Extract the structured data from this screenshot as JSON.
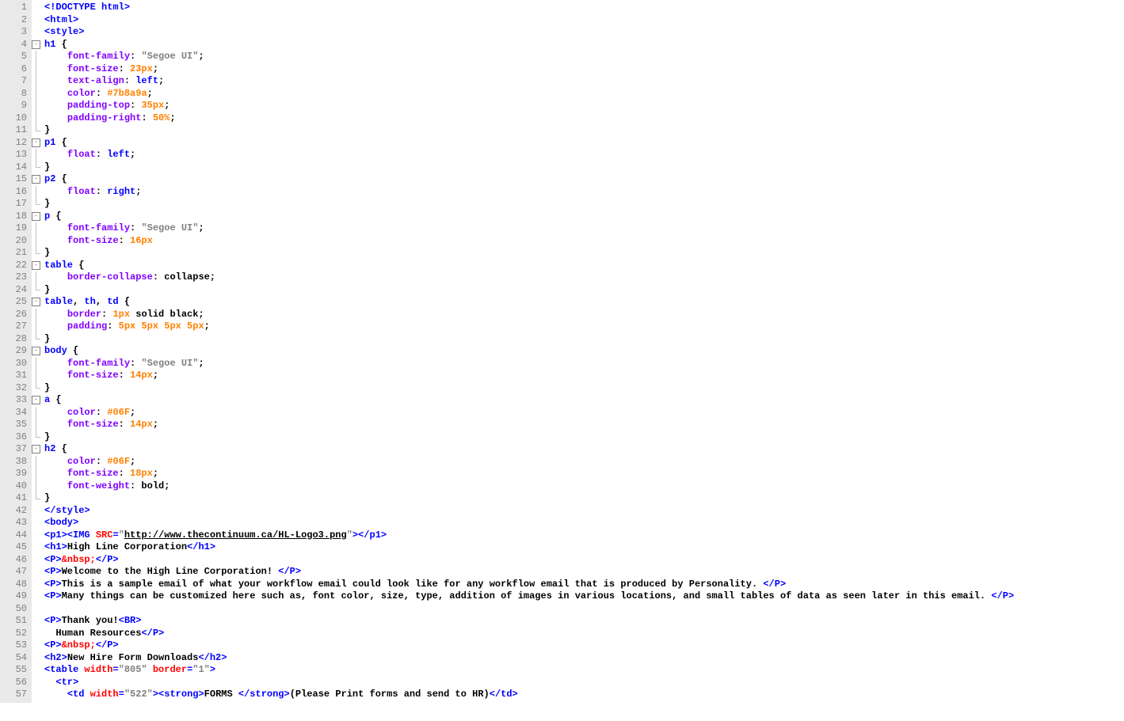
{
  "editor": {
    "lines": [
      {
        "n": 1,
        "fold": null,
        "tokens": [
          {
            "c": "t-kw",
            "t": "<!DOCTYPE html>"
          }
        ]
      },
      {
        "n": 2,
        "fold": null,
        "tokens": [
          {
            "c": "t-kw",
            "t": "<html>"
          }
        ]
      },
      {
        "n": 3,
        "fold": null,
        "tokens": [
          {
            "c": "t-kw",
            "t": "<style>"
          }
        ]
      },
      {
        "n": 4,
        "fold": "open",
        "tokens": [
          {
            "c": "t-sel",
            "t": "h1"
          },
          {
            "c": "t-val",
            "t": " {"
          }
        ]
      },
      {
        "n": 5,
        "fold": "mid",
        "indent": 1,
        "tokens": [
          {
            "c": "t-prop",
            "t": "font-family"
          },
          {
            "c": "t-val",
            "t": ": "
          },
          {
            "c": "t-str",
            "t": "\"Segoe UI\""
          },
          {
            "c": "t-val",
            "t": ";"
          }
        ]
      },
      {
        "n": 6,
        "fold": "mid",
        "indent": 1,
        "tokens": [
          {
            "c": "t-prop",
            "t": "font-size"
          },
          {
            "c": "t-val",
            "t": ": "
          },
          {
            "c": "t-num",
            "t": "23px"
          },
          {
            "c": "t-val",
            "t": ";"
          }
        ]
      },
      {
        "n": 7,
        "fold": "mid",
        "indent": 1,
        "tokens": [
          {
            "c": "t-prop",
            "t": "text-align"
          },
          {
            "c": "t-val",
            "t": ": "
          },
          {
            "c": "t-sel",
            "t": "left"
          },
          {
            "c": "t-val",
            "t": ";"
          }
        ]
      },
      {
        "n": 8,
        "fold": "mid",
        "indent": 1,
        "tokens": [
          {
            "c": "t-prop",
            "t": "color"
          },
          {
            "c": "t-val",
            "t": ": "
          },
          {
            "c": "t-num",
            "t": "#7b8a9a"
          },
          {
            "c": "t-val",
            "t": ";"
          }
        ]
      },
      {
        "n": 9,
        "fold": "mid",
        "indent": 1,
        "tokens": [
          {
            "c": "t-prop",
            "t": "padding-top"
          },
          {
            "c": "t-val",
            "t": ": "
          },
          {
            "c": "t-num",
            "t": "35px"
          },
          {
            "c": "t-val",
            "t": ";"
          }
        ]
      },
      {
        "n": 10,
        "fold": "mid",
        "indent": 1,
        "tokens": [
          {
            "c": "t-prop",
            "t": "padding-right"
          },
          {
            "c": "t-val",
            "t": ": "
          },
          {
            "c": "t-num",
            "t": "50%"
          },
          {
            "c": "t-val",
            "t": ";"
          }
        ]
      },
      {
        "n": 11,
        "fold": "end",
        "tokens": [
          {
            "c": "t-val",
            "t": "}"
          }
        ]
      },
      {
        "n": 12,
        "fold": "open",
        "tokens": [
          {
            "c": "t-sel",
            "t": "p1"
          },
          {
            "c": "t-val",
            "t": " {"
          }
        ]
      },
      {
        "n": 13,
        "fold": "mid",
        "indent": 1,
        "tokens": [
          {
            "c": "t-prop",
            "t": "float"
          },
          {
            "c": "t-val",
            "t": ": "
          },
          {
            "c": "t-sel",
            "t": "left"
          },
          {
            "c": "t-val",
            "t": ";"
          }
        ]
      },
      {
        "n": 14,
        "fold": "end",
        "tokens": [
          {
            "c": "t-val",
            "t": "}"
          }
        ]
      },
      {
        "n": 15,
        "fold": "open",
        "tokens": [
          {
            "c": "t-sel",
            "t": "p2"
          },
          {
            "c": "t-val",
            "t": " {"
          }
        ]
      },
      {
        "n": 16,
        "fold": "mid",
        "indent": 1,
        "tokens": [
          {
            "c": "t-prop",
            "t": "float"
          },
          {
            "c": "t-val",
            "t": ": "
          },
          {
            "c": "t-sel",
            "t": "right"
          },
          {
            "c": "t-val",
            "t": ";"
          }
        ]
      },
      {
        "n": 17,
        "fold": "end",
        "tokens": [
          {
            "c": "t-val",
            "t": "}"
          }
        ]
      },
      {
        "n": 18,
        "fold": "open",
        "tokens": [
          {
            "c": "t-sel",
            "t": "p"
          },
          {
            "c": "t-val",
            "t": " {"
          }
        ]
      },
      {
        "n": 19,
        "fold": "mid",
        "indent": 1,
        "tokens": [
          {
            "c": "t-prop",
            "t": "font-family"
          },
          {
            "c": "t-val",
            "t": ": "
          },
          {
            "c": "t-str",
            "t": "\"Segoe UI\""
          },
          {
            "c": "t-val",
            "t": ";"
          }
        ]
      },
      {
        "n": 20,
        "fold": "mid",
        "indent": 1,
        "tokens": [
          {
            "c": "t-prop",
            "t": "font-size"
          },
          {
            "c": "t-val",
            "t": ": "
          },
          {
            "c": "t-num",
            "t": "16px"
          }
        ]
      },
      {
        "n": 21,
        "fold": "end",
        "tokens": [
          {
            "c": "t-val",
            "t": "}"
          }
        ]
      },
      {
        "n": 22,
        "fold": "open",
        "tokens": [
          {
            "c": "t-sel",
            "t": "table"
          },
          {
            "c": "t-val",
            "t": " {"
          }
        ]
      },
      {
        "n": 23,
        "fold": "mid",
        "indent": 1,
        "tokens": [
          {
            "c": "t-prop",
            "t": "border-collapse"
          },
          {
            "c": "t-val",
            "t": ": collapse;"
          }
        ]
      },
      {
        "n": 24,
        "fold": "end",
        "tokens": [
          {
            "c": "t-val",
            "t": "}"
          }
        ]
      },
      {
        "n": 25,
        "fold": "open",
        "tokens": [
          {
            "c": "t-sel",
            "t": "table"
          },
          {
            "c": "t-val",
            "t": ", "
          },
          {
            "c": "t-sel",
            "t": "th"
          },
          {
            "c": "t-val",
            "t": ", "
          },
          {
            "c": "t-sel",
            "t": "td"
          },
          {
            "c": "t-val",
            "t": " {"
          }
        ]
      },
      {
        "n": 26,
        "fold": "mid",
        "indent": 1,
        "tokens": [
          {
            "c": "t-prop",
            "t": "border"
          },
          {
            "c": "t-val",
            "t": ": "
          },
          {
            "c": "t-num",
            "t": "1px"
          },
          {
            "c": "t-val",
            "t": " solid black;"
          }
        ]
      },
      {
        "n": 27,
        "fold": "mid",
        "indent": 1,
        "tokens": [
          {
            "c": "t-prop",
            "t": "padding"
          },
          {
            "c": "t-val",
            "t": ": "
          },
          {
            "c": "t-num",
            "t": "5px 5px 5px 5px"
          },
          {
            "c": "t-val",
            "t": ";"
          }
        ]
      },
      {
        "n": 28,
        "fold": "end",
        "tokens": [
          {
            "c": "t-val",
            "t": "}"
          }
        ]
      },
      {
        "n": 29,
        "fold": "open",
        "tokens": [
          {
            "c": "t-sel",
            "t": "body"
          },
          {
            "c": "t-val",
            "t": " {"
          }
        ]
      },
      {
        "n": 30,
        "fold": "mid",
        "indent": 1,
        "tokens": [
          {
            "c": "t-prop",
            "t": "font-family"
          },
          {
            "c": "t-val",
            "t": ": "
          },
          {
            "c": "t-str",
            "t": "\"Segoe UI\""
          },
          {
            "c": "t-val",
            "t": ";"
          }
        ]
      },
      {
        "n": 31,
        "fold": "mid",
        "indent": 1,
        "tokens": [
          {
            "c": "t-prop",
            "t": "font-size"
          },
          {
            "c": "t-val",
            "t": ": "
          },
          {
            "c": "t-num",
            "t": "14px"
          },
          {
            "c": "t-val",
            "t": ";"
          }
        ]
      },
      {
        "n": 32,
        "fold": "end",
        "tokens": [
          {
            "c": "t-val",
            "t": "}"
          }
        ]
      },
      {
        "n": 33,
        "fold": "open",
        "tokens": [
          {
            "c": "t-sel",
            "t": "a"
          },
          {
            "c": "t-val",
            "t": " {"
          }
        ]
      },
      {
        "n": 34,
        "fold": "mid",
        "indent": 1,
        "tokens": [
          {
            "c": "t-prop",
            "t": "color"
          },
          {
            "c": "t-val",
            "t": ": "
          },
          {
            "c": "t-num",
            "t": "#06F"
          },
          {
            "c": "t-val",
            "t": ";"
          }
        ]
      },
      {
        "n": 35,
        "fold": "mid",
        "indent": 1,
        "tokens": [
          {
            "c": "t-prop",
            "t": "font-size"
          },
          {
            "c": "t-val",
            "t": ": "
          },
          {
            "c": "t-num",
            "t": "14px"
          },
          {
            "c": "t-val",
            "t": ";"
          }
        ]
      },
      {
        "n": 36,
        "fold": "end",
        "tokens": [
          {
            "c": "t-val",
            "t": "}"
          }
        ]
      },
      {
        "n": 37,
        "fold": "open",
        "tokens": [
          {
            "c": "t-sel",
            "t": "h2"
          },
          {
            "c": "t-val",
            "t": " {"
          }
        ]
      },
      {
        "n": 38,
        "fold": "mid",
        "indent": 1,
        "tokens": [
          {
            "c": "t-prop",
            "t": "color"
          },
          {
            "c": "t-val",
            "t": ": "
          },
          {
            "c": "t-num",
            "t": "#06F"
          },
          {
            "c": "t-val",
            "t": ";"
          }
        ]
      },
      {
        "n": 39,
        "fold": "mid",
        "indent": 1,
        "tokens": [
          {
            "c": "t-prop",
            "t": "font-size"
          },
          {
            "c": "t-val",
            "t": ": "
          },
          {
            "c": "t-num",
            "t": "18px"
          },
          {
            "c": "t-val",
            "t": ";"
          }
        ]
      },
      {
        "n": 40,
        "fold": "mid",
        "indent": 1,
        "tokens": [
          {
            "c": "t-prop",
            "t": "font-weight"
          },
          {
            "c": "t-val",
            "t": ": bold;"
          }
        ]
      },
      {
        "n": 41,
        "fold": "end",
        "tokens": [
          {
            "c": "t-val",
            "t": "}"
          }
        ]
      },
      {
        "n": 42,
        "fold": null,
        "tokens": [
          {
            "c": "t-kw",
            "t": "</style>"
          }
        ]
      },
      {
        "n": 43,
        "fold": null,
        "tokens": [
          {
            "c": "t-kw",
            "t": "<body>"
          }
        ]
      },
      {
        "n": 44,
        "fold": null,
        "tokens": [
          {
            "c": "t-kw",
            "t": "<p1><"
          },
          {
            "c": "t-sel",
            "t": "IMG"
          },
          {
            "c": "t-kw",
            "t": " "
          },
          {
            "c": "t-attr",
            "t": "SRC"
          },
          {
            "c": "t-kw",
            "t": "="
          },
          {
            "c": "t-str",
            "t": "\""
          },
          {
            "c": "t-url",
            "t": "http://www.thecontinuum.ca/HL-Logo3.png"
          },
          {
            "c": "t-str",
            "t": "\""
          },
          {
            "c": "t-kw",
            "t": "></p1>"
          }
        ]
      },
      {
        "n": 45,
        "fold": null,
        "tokens": [
          {
            "c": "t-kw",
            "t": "<h1>"
          },
          {
            "c": "t-text",
            "t": "High Line Corporation"
          },
          {
            "c": "t-kw",
            "t": "</h1>"
          }
        ]
      },
      {
        "n": 46,
        "fold": null,
        "tokens": [
          {
            "c": "t-kw",
            "t": "<P>"
          },
          {
            "c": "t-attr",
            "t": "&nbsp;"
          },
          {
            "c": "t-kw",
            "t": "</P>"
          }
        ]
      },
      {
        "n": 47,
        "fold": null,
        "tokens": [
          {
            "c": "t-kw",
            "t": "<P>"
          },
          {
            "c": "t-text",
            "t": "Welcome to the High Line Corporation! "
          },
          {
            "c": "t-kw",
            "t": "</P>"
          }
        ]
      },
      {
        "n": 48,
        "fold": null,
        "tokens": [
          {
            "c": "t-kw",
            "t": "<P>"
          },
          {
            "c": "t-text",
            "t": "This is a sample email of what your workflow email could look like for any workflow email that is produced by Personality. "
          },
          {
            "c": "t-kw",
            "t": "</P>"
          }
        ]
      },
      {
        "n": 49,
        "fold": null,
        "tokens": [
          {
            "c": "t-kw",
            "t": "<P>"
          },
          {
            "c": "t-text",
            "t": "Many things can be customized here such as, font color, size, type, addition of images in various locations, and small tables of data as seen later in this email. "
          },
          {
            "c": "t-kw",
            "t": "</P>"
          }
        ]
      },
      {
        "n": 50,
        "fold": null,
        "tokens": []
      },
      {
        "n": 51,
        "fold": null,
        "tokens": [
          {
            "c": "t-kw",
            "t": "<P>"
          },
          {
            "c": "t-text",
            "t": "Thank you!"
          },
          {
            "c": "t-kw",
            "t": "<BR>"
          }
        ]
      },
      {
        "n": 52,
        "fold": null,
        "indent": 0,
        "raw": "  ",
        "tokens": [
          {
            "c": "t-text",
            "t": "Human Resources"
          },
          {
            "c": "t-kw",
            "t": "</P>"
          }
        ]
      },
      {
        "n": 53,
        "fold": null,
        "tokens": [
          {
            "c": "t-kw",
            "t": "<P>"
          },
          {
            "c": "t-attr",
            "t": "&nbsp;"
          },
          {
            "c": "t-kw",
            "t": "</P>"
          }
        ]
      },
      {
        "n": 54,
        "fold": null,
        "tokens": [
          {
            "c": "t-kw",
            "t": "<h2>"
          },
          {
            "c": "t-text",
            "t": "New Hire Form Downloads"
          },
          {
            "c": "t-kw",
            "t": "</h2>"
          }
        ]
      },
      {
        "n": 55,
        "fold": null,
        "tokens": [
          {
            "c": "t-kw",
            "t": "<table "
          },
          {
            "c": "t-attr",
            "t": "width"
          },
          {
            "c": "t-kw",
            "t": "="
          },
          {
            "c": "t-str",
            "t": "\"805\""
          },
          {
            "c": "t-kw",
            "t": " "
          },
          {
            "c": "t-attr",
            "t": "border"
          },
          {
            "c": "t-kw",
            "t": "="
          },
          {
            "c": "t-str",
            "t": "\"1\""
          },
          {
            "c": "t-kw",
            "t": ">"
          }
        ]
      },
      {
        "n": 56,
        "fold": null,
        "raw": "  ",
        "tokens": [
          {
            "c": "t-kw",
            "t": "<tr>"
          }
        ]
      },
      {
        "n": 57,
        "fold": null,
        "raw": "    ",
        "tokens": [
          {
            "c": "t-kw",
            "t": "<td "
          },
          {
            "c": "t-attr",
            "t": "width"
          },
          {
            "c": "t-kw",
            "t": "="
          },
          {
            "c": "t-str",
            "t": "\"522\""
          },
          {
            "c": "t-kw",
            "t": "><strong>"
          },
          {
            "c": "t-text",
            "t": "FORMS "
          },
          {
            "c": "t-kw",
            "t": "</strong>"
          },
          {
            "c": "t-text",
            "t": "(Please Print forms and send to HR)"
          },
          {
            "c": "t-kw",
            "t": "</td>"
          }
        ]
      }
    ]
  }
}
